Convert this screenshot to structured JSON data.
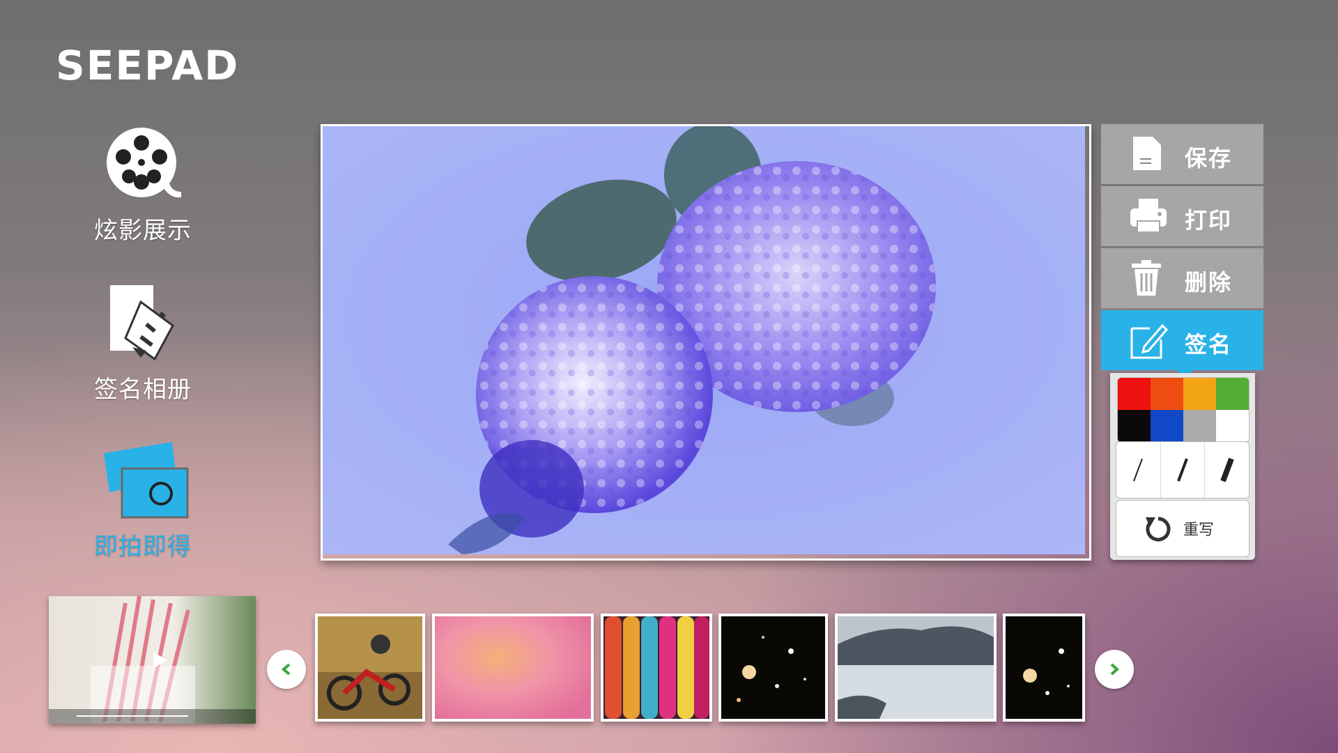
{
  "app": {
    "brand": "SEEPAD"
  },
  "nav": {
    "items": [
      {
        "label": "炫影展示",
        "icon": "film-reel-icon",
        "active": false
      },
      {
        "label": "签名相册",
        "icon": "signature-album-icon",
        "active": false
      },
      {
        "label": "即拍即得",
        "icon": "instant-photo-icon",
        "active": true
      }
    ]
  },
  "menu": {
    "save": "保存",
    "print": "打印",
    "delete": "删除",
    "sign": "签名"
  },
  "sign_panel": {
    "colors": [
      "#ee1111",
      "#ef4c12",
      "#f2a414",
      "#54ad35",
      "#0a0a0a",
      "#1048c8",
      "#aaaaaa",
      "#ffffff"
    ],
    "pen_sizes": [
      "thin",
      "medium",
      "thick"
    ],
    "rewrite_label": "重写"
  },
  "viewer": {
    "subject": "hydrangea-photo"
  },
  "gallery": {
    "video": "video-thumbnail",
    "thumbnails": [
      "dirt-bike",
      "pink-blur",
      "colorful-lanterns",
      "galaxy",
      "glacier",
      "galaxy-2"
    ]
  },
  "colors": {
    "accent": "#29b2e8",
    "menu_gray": "#a6a6a6",
    "arrow_green": "#3aa63a"
  }
}
